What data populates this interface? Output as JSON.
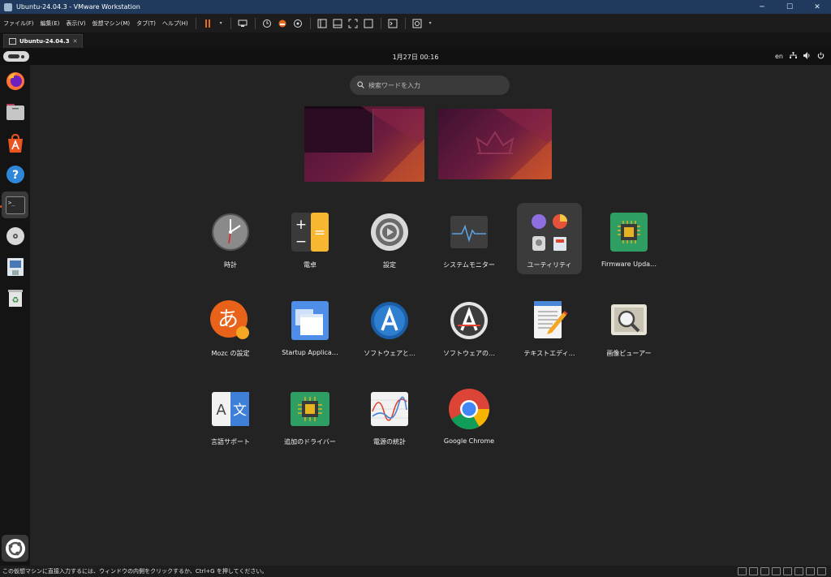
{
  "window": {
    "title": "Ubuntu-24.04.3 - VMware Workstation",
    "minimize": "─",
    "maximize": "☐",
    "close": "✕"
  },
  "menu": [
    "ファイル(F)",
    "編集(E)",
    "表示(V)",
    "仮想マシン(M)",
    "タブ(T)",
    "ヘルプ(H)"
  ],
  "tab": {
    "label": "Ubuntu-24.04.3",
    "close": "✕"
  },
  "guest": {
    "clock": "1月27日  00:16",
    "keyboard": "en",
    "search_placeholder": "検索ワードを入力"
  },
  "apps": [
    {
      "label": "時計",
      "icon": "clock-icon"
    },
    {
      "label": "電卓",
      "icon": "calculator-icon"
    },
    {
      "label": "設定",
      "icon": "settings-gear-icon"
    },
    {
      "label": "システムモニター",
      "icon": "system-monitor-icon"
    },
    {
      "label": "ユーティリティ",
      "icon": "utilities-folder-icon"
    },
    {
      "label": "Firmware Upda…",
      "icon": "firmware-chip-icon"
    },
    {
      "label": "Mozc の設定",
      "icon": "mozc-icon"
    },
    {
      "label": "Startup Applica…",
      "icon": "startup-applications-icon"
    },
    {
      "label": "ソフトウェアと…",
      "icon": "software-updates-icon"
    },
    {
      "label": "ソフトウェアの…",
      "icon": "software-updater-icon"
    },
    {
      "label": "テキストエディ…",
      "icon": "text-editor-icon"
    },
    {
      "label": "画像ビューアー",
      "icon": "image-viewer-icon"
    },
    {
      "label": "言語サポート",
      "icon": "language-support-icon"
    },
    {
      "label": "追加のドライバー",
      "icon": "additional-drivers-icon"
    },
    {
      "label": "電源の統計",
      "icon": "power-statistics-icon"
    },
    {
      "label": "Google Chrome",
      "icon": "chrome-icon"
    }
  ],
  "icon_text": {
    "calc_plus": "+",
    "calc_minus": "−",
    "calc_eq": "=",
    "mozc": "あ",
    "lang_a": "A",
    "lang_b": "文",
    "help": "?",
    "terminal": ">_",
    "recycle": "♻"
  },
  "statusbar": {
    "message": "この仮想マシンに直接入力するには、ウィンドウの内側をクリックするか、Ctrl+G を押してください。"
  },
  "colors": {
    "ubuntu_orange": "#e95420",
    "vmware_titlebar": "#1f3a5c",
    "guest_bg": "#232323"
  }
}
